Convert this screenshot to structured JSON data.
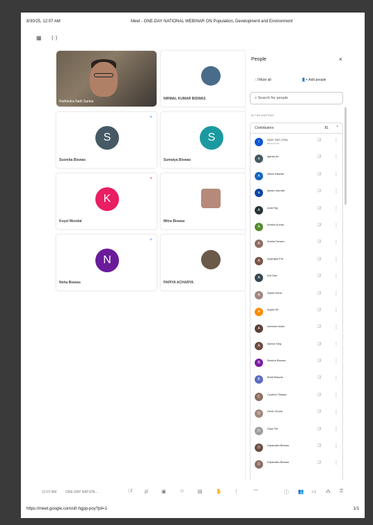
{
  "print_header": {
    "datetime": "8/30/25, 12:07 AM",
    "title": "Meet - ONE-DAY NATIONAL WEBINAR ON Population, Development and Environment"
  },
  "print_footer": {
    "url": "https://meet.google.com/ufr-hgpp-poy?pli=1",
    "page": "1/1"
  },
  "tiles": [
    {
      "name": "Rathindra Nath Sarkar",
      "type": "video"
    },
    {
      "name": "NIRMAL KUMAR BISWAS",
      "type": "photo",
      "color": "#4a6b8a"
    },
    {
      "name": "Susmita Biswas",
      "type": "letter",
      "letter": "S",
      "color": "#455a64"
    },
    {
      "name": "Sumaiya Biswas",
      "type": "letter",
      "letter": "S",
      "color": "#1a9aa0"
    },
    {
      "name": "Koyel Mondal",
      "type": "letter",
      "letter": "K",
      "color": "#e91e63"
    },
    {
      "name": "Mitra Biswas",
      "type": "photo",
      "color": "#b58a7a"
    },
    {
      "name": "Neha Biswas",
      "type": "letter",
      "letter": "N",
      "color": "#6a1b9a"
    },
    {
      "name": "PAPIYA ACHARYA",
      "type": "photo",
      "color": "#6b5a4a"
    }
  ],
  "panel": {
    "title": "People",
    "close": "×",
    "mute_all": "Mute all",
    "add_people": "Add people",
    "search_placeholder": "Search for people",
    "section": "IN THE MEETING",
    "contributors": "Contributors",
    "count": "81",
    "participants": [
      {
        "name": "IQAC SAC (You)",
        "sub": "Meeting host",
        "letter": "I",
        "color": "#0b57d0"
      },
      {
        "name": "ajanta de",
        "sub": "",
        "letter": "a",
        "color": "#455a64"
      },
      {
        "name": "Alesh Biswas",
        "sub": "",
        "letter": "A",
        "color": "#1565c0"
      },
      {
        "name": "akash mandal",
        "sub": "",
        "letter": "a",
        "color": "#0d47a1"
      },
      {
        "name": "Amit Raj",
        "sub": "",
        "letter": "A",
        "color": "#263238"
      },
      {
        "name": "Amrita Kundu",
        "sub": "",
        "letter": "A",
        "color": "#558b2f"
      },
      {
        "name": "Ankita Dewan",
        "sub": "",
        "letter": "A",
        "color": "#8d6e63"
      },
      {
        "name": "Aparajita Pal",
        "sub": "",
        "letter": "A",
        "color": "#795548"
      },
      {
        "name": "Arit Das",
        "sub": "",
        "letter": "A",
        "color": "#37474f"
      },
      {
        "name": "Arpita Saha",
        "sub": "",
        "letter": "A",
        "color": "#a1887f"
      },
      {
        "name": "Arpita Sil",
        "sub": "",
        "letter": "A",
        "color": "#fb8c00"
      },
      {
        "name": "Ashraful Islam",
        "sub": "",
        "letter": "A",
        "color": "#5d4037"
      },
      {
        "name": "Asima Sing",
        "sub": "",
        "letter": "A",
        "color": "#6d4c41"
      },
      {
        "name": "Barsha Biswas",
        "sub": "",
        "letter": "B",
        "color": "#7b1fa2"
      },
      {
        "name": "Bristi Biswas",
        "sub": "",
        "letter": "B",
        "color": "#5c6bc0"
      },
      {
        "name": "Cynthia Tikadar",
        "sub": "",
        "letter": "C",
        "color": "#8d6e63"
      },
      {
        "name": "Dhriti Ghosh",
        "sub": "",
        "letter": "D",
        "color": "#a1887f"
      },
      {
        "name": "Dipa Pal",
        "sub": "",
        "letter": "D",
        "color": "#9e9e9e"
      },
      {
        "name": "Dipanwita Biswas",
        "sub": "",
        "letter": "D",
        "color": "#6d4c41"
      },
      {
        "name": "Dipanwita Biswas",
        "sub": "",
        "letter": "D",
        "color": "#8d6e63"
      }
    ]
  },
  "toolbar": {
    "time": "12:07 AM",
    "meeting": "ONE-DAY NATION..."
  }
}
